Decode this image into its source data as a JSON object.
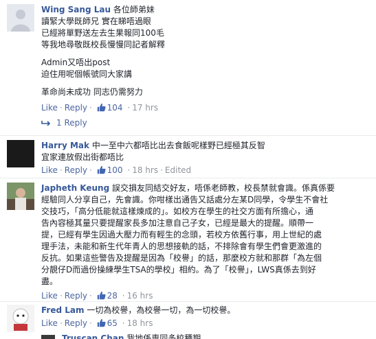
{
  "comments": [
    {
      "author": "Wing Sang Lau",
      "lines": [
        "各位師弟妹",
        "讀緊大學既師兄 實在睇唔過眼",
        "已經將單野送左去生果報同100毛",
        "等我地尋敬既校長慢慢同記者解釋",
        "Admin又唔出post",
        "迫住用呢個帳號同大家講",
        "革命尚未成功 同志仍需努力"
      ],
      "like": "Like",
      "reply": "Reply",
      "likes": "104",
      "time": "17 hrs",
      "replies_label": "1 Reply"
    },
    {
      "author": "Harry Mak",
      "lines": [
        "中一至中六都唔比出去食飯呢樣野已經極其反智",
        "宜家連放假出街都唔比"
      ],
      "like": "Like",
      "reply": "Reply",
      "likes": "100",
      "time": "18 hrs",
      "edited": "Edited"
    },
    {
      "author": "Japheth Keung",
      "lines": [
        "誤交損友同結交好友，唔係老師教，校長禁就會識。係真係要",
        "經驗同人分享自己，先會識。你咁樣出通告又話處分左某D同學，令學生不會社",
        "交技巧，「高分低能就這樣煉成的」。如校方在學生的社交方面有所擔心，通",
        "告內容極其量只要提醒家長多加注意自己子女，已經是最大的提醒。順帶一",
        "提，已經有學生因過大壓力而有輕生的念頭，若校方依舊行事，用上世紀的處",
        "理手法，未能和新生代年青人的思想接軌的話，不排除會有學生們會更激進的",
        "反抗。如果這些警告及提醒是因為「校譽」的話，那麼校方就和那群「為左個",
        "分靚仔D而過份操練學生TSA的學校」相約。為了「校譽」，LWS真係去到好",
        "盡。"
      ],
      "like": "Like",
      "reply": "Reply",
      "likes": "28",
      "time": "16 hrs"
    },
    {
      "author": "Fred Lam",
      "lines": [
        "一切為校譽，為校譽一切，為一切校譽。"
      ],
      "like": "Like",
      "reply": "Reply",
      "likes": "65",
      "time": "18 hrs"
    },
    {
      "author": "Truscan Chan",
      "lines": [
        "我地係専同多校種期"
      ]
    }
  ],
  "colors": {
    "link": "#365899",
    "meta": "#90949c",
    "text": "#1d2129",
    "like_blue": "#4267b2"
  },
  "icons": {
    "like": "thumbs-up-icon",
    "reply_arrow": "reply-arrow-icon"
  }
}
